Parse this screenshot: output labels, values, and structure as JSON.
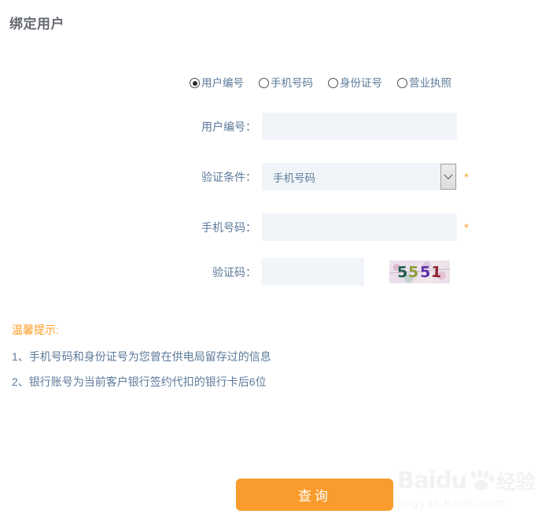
{
  "page": {
    "title": "绑定用户"
  },
  "identity_type": {
    "selected": "用户编号",
    "options": [
      {
        "label": "用户编号",
        "checked": true
      },
      {
        "label": "手机号码",
        "checked": false
      },
      {
        "label": "身份证号",
        "checked": false
      },
      {
        "label": "营业执照",
        "checked": false
      }
    ]
  },
  "form": {
    "user_no": {
      "label": "用户编号：",
      "value": "",
      "placeholder": "",
      "required_mark": ""
    },
    "verify_condition": {
      "label": "验证条件：",
      "value": "手机号码",
      "required_mark": "*",
      "options": [
        "手机号码"
      ]
    },
    "mobile": {
      "label": "手机号码：",
      "value": "",
      "placeholder": "",
      "required_mark": "*"
    },
    "captcha": {
      "label": "验证码：",
      "value": "",
      "placeholder": "",
      "image_text": "5551",
      "digits": [
        "5",
        "5",
        "5",
        "1"
      ]
    }
  },
  "tips": {
    "title": "温馨提示:",
    "items": [
      "1、手机号码和身份证号为您曾在供电局留存过的信息",
      "2、银行账号为当前客户银行签约代扣的银行卡后6位"
    ]
  },
  "actions": {
    "submit_label": "查询"
  },
  "watermark": {
    "brand": "Baidu",
    "brand_cn": "经验",
    "url": "jingyan.baidu.com"
  },
  "colors": {
    "accent_orange": "#fa9c2d",
    "tip_orange": "#ff9c23",
    "label_blue": "#5b7a99",
    "field_bg": "#f1f5fa",
    "title_gray": "#666a70"
  }
}
